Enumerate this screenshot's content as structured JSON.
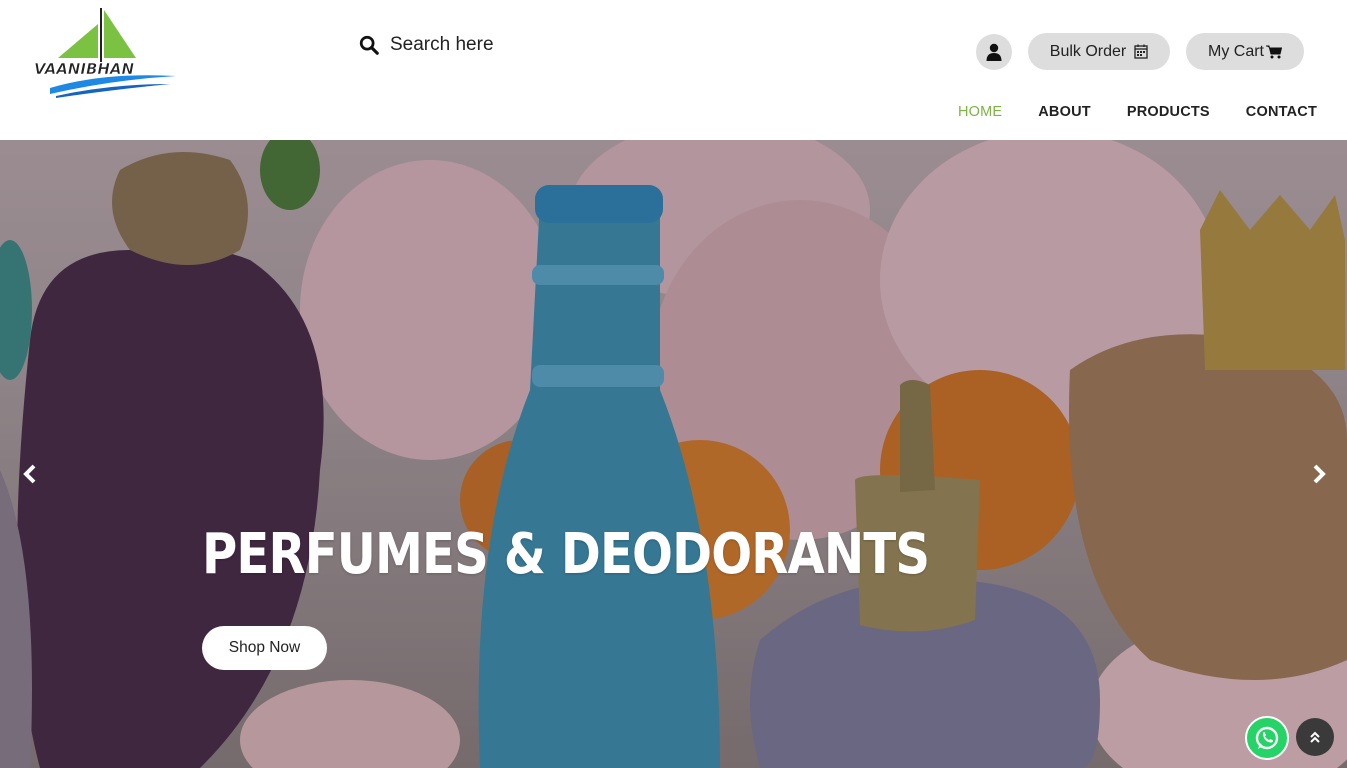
{
  "brand": {
    "logo_text": "VAANIBHAN",
    "logo_colors": {
      "sail": "#7cc242",
      "text": "#222222",
      "wave": "#1e88e5"
    }
  },
  "search": {
    "placeholder": "Search here",
    "icon": "search-icon"
  },
  "header_actions": {
    "user_icon": "user-icon",
    "bulk_order_label": "Bulk Order",
    "bulk_order_icon": "calendar-icon",
    "cart_label": "My Cart",
    "cart_icon": "cart-icon"
  },
  "nav": {
    "items": [
      {
        "label": "HOME",
        "active": true
      },
      {
        "label": "ABOUT",
        "active": false
      },
      {
        "label": "PRODUCTS",
        "active": false
      },
      {
        "label": "CONTACT",
        "active": false
      }
    ]
  },
  "hero": {
    "headline": "PERFUMES & DEODORANTS",
    "cta_label": "Shop Now",
    "prev_icon": "chevron-left-icon",
    "next_icon": "chevron-right-icon"
  },
  "floating": {
    "whatsapp_icon": "whatsapp-icon",
    "scroll_top_icon": "double-chevron-up-icon"
  },
  "colors": {
    "accent": "#7cb342",
    "pill_bg": "#dddddd",
    "whatsapp": "#25d366"
  }
}
